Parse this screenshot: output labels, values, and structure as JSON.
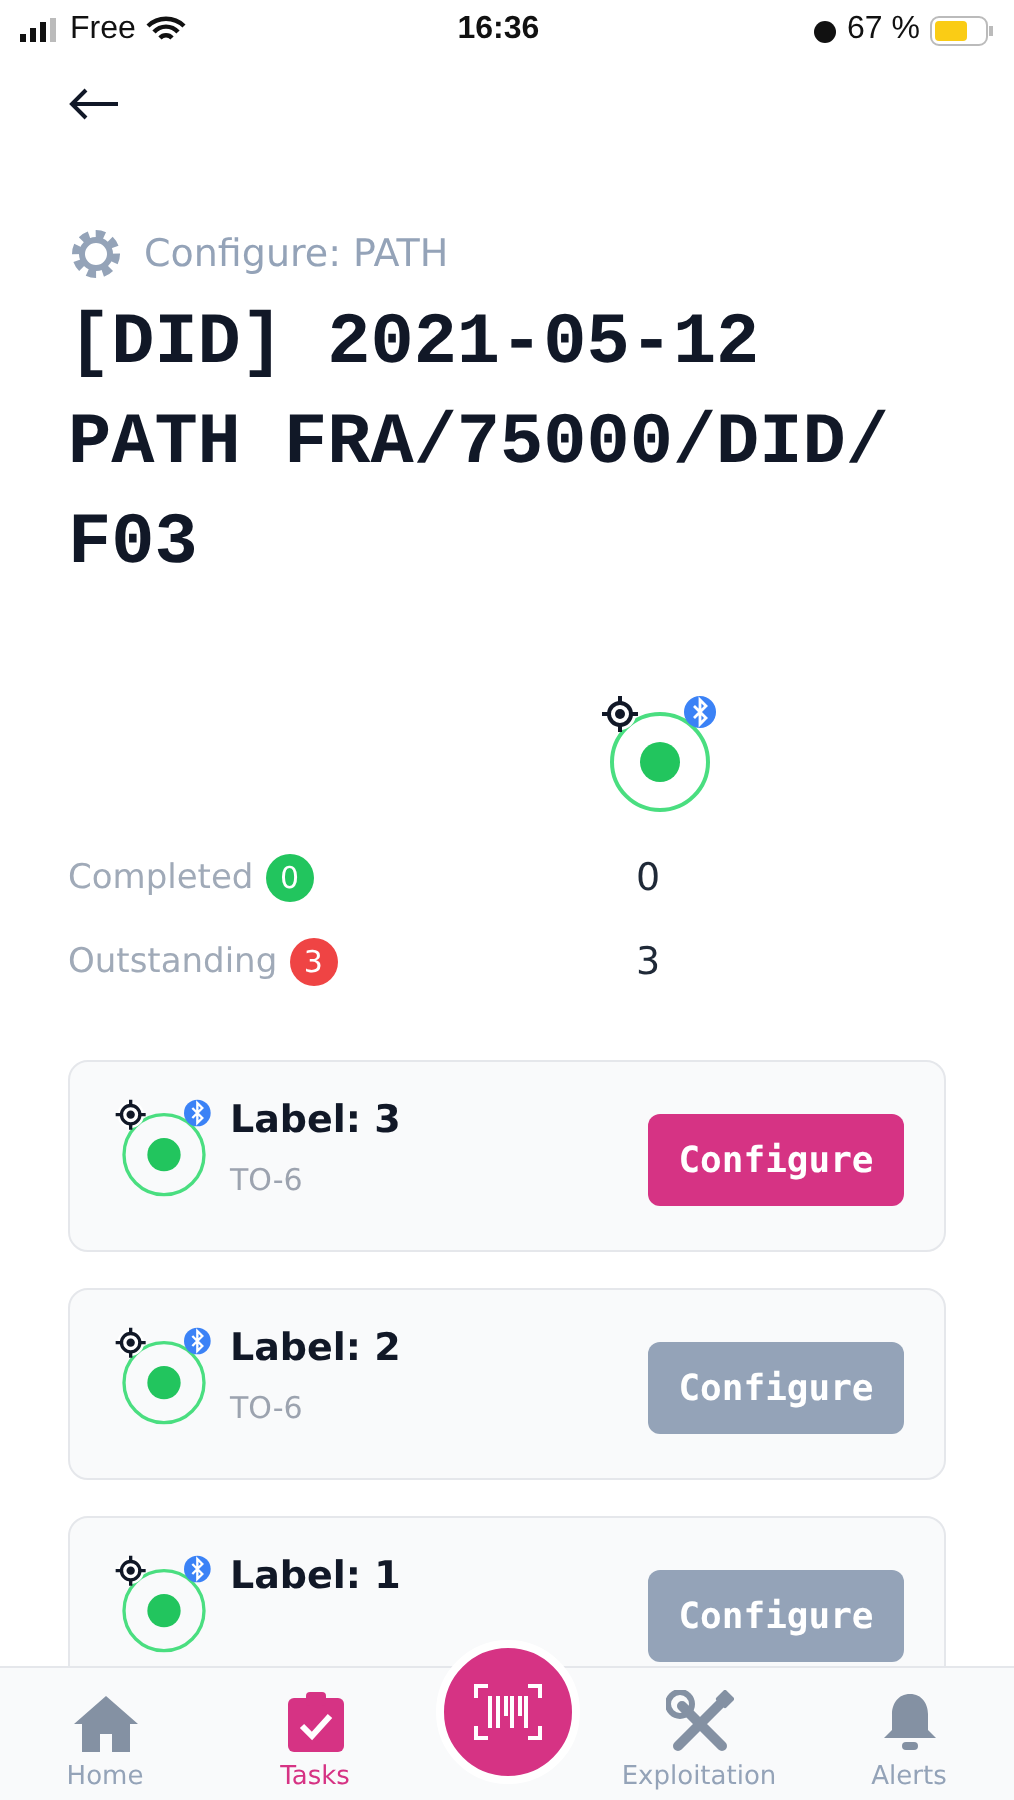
{
  "status_bar": {
    "carrier": "Free",
    "time": "16:36",
    "battery": "67 %"
  },
  "header": {
    "subtitle": "Configure: PATH",
    "title_lines": [
      "[DID] 2021-05-12",
      "PATH FRA/75000/DID/",
      "F03"
    ]
  },
  "stats": [
    {
      "label": "Completed",
      "count": "0",
      "color": "#22c55e",
      "value": "0"
    },
    {
      "label": "Outstanding",
      "count": "3",
      "color": "#ef4444",
      "value": "3"
    }
  ],
  "labels": [
    {
      "title": "Label: 3",
      "subtitle": "TO-6",
      "button": "Configure",
      "disabled": false
    },
    {
      "title": "Label: 2",
      "subtitle": "TO-6",
      "button": "Configure",
      "disabled": true
    },
    {
      "title": "Label: 1",
      "button": "Configure",
      "disabled": true
    }
  ],
  "tab_bar": [
    {
      "kind": "home",
      "label": "Home",
      "selected": false
    },
    {
      "kind": "tasks",
      "label": "Tasks",
      "selected": true
    },
    {
      "kind": "scan",
      "selected": false
    },
    {
      "kind": "tools",
      "label": "Exploitation",
      "selected": false
    },
    {
      "kind": "alerts",
      "label": "Alerts",
      "selected": false
    }
  ]
}
